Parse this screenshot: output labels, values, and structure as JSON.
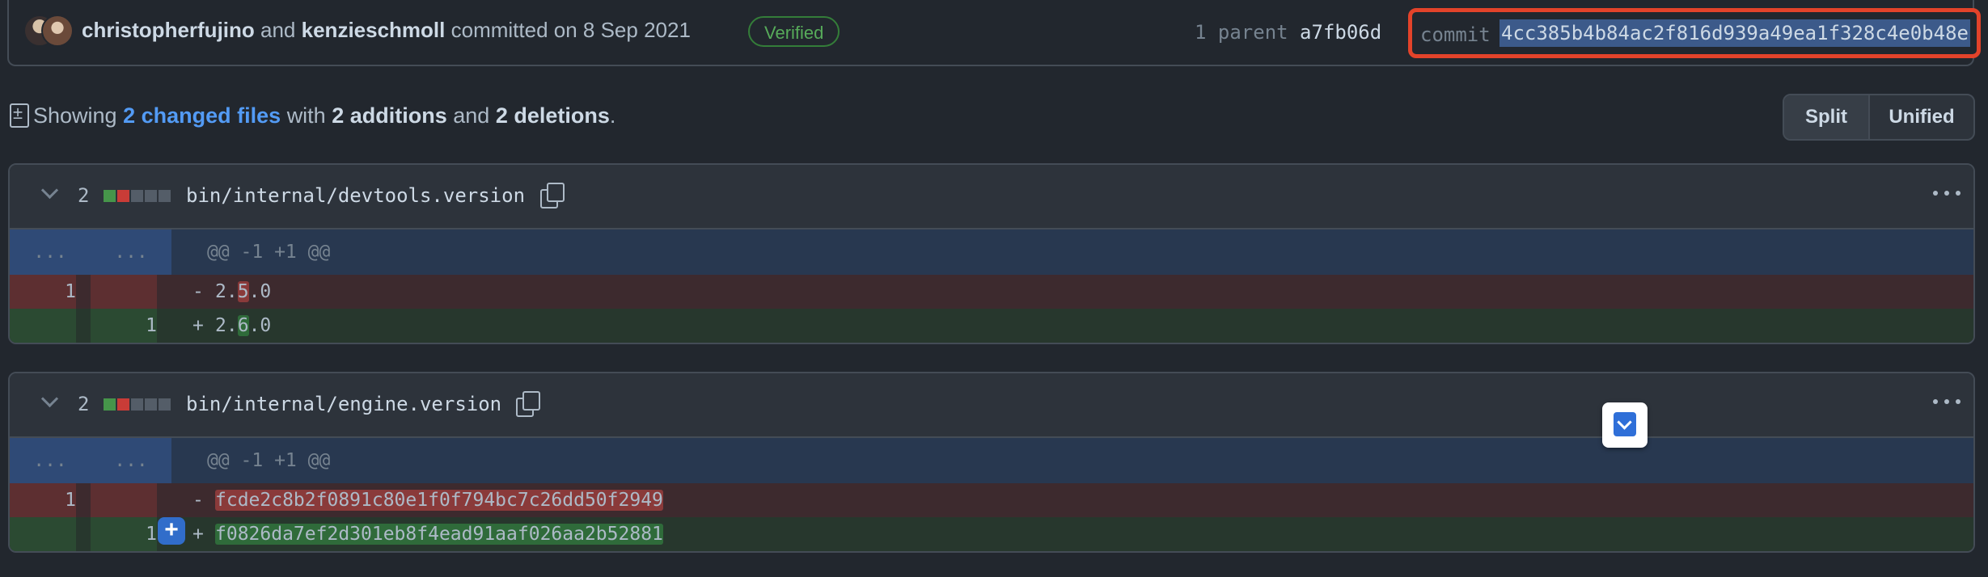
{
  "commit": {
    "author1": "christopherfujino",
    "joiner": "and",
    "author2": "kenzieschmoll",
    "committed_on": "committed on 8 Sep 2021",
    "verified_label": "Verified",
    "parent_label": "1 parent",
    "parent_sha": "a7fb06d",
    "commit_label": "commit",
    "commit_sha": "4cc385b4b84ac2f816d939a49ea1f328c4e0b48e"
  },
  "summary": {
    "showing": "Showing",
    "changed_files": "2 changed files",
    "with": "with",
    "additions": "2 additions",
    "and": "and",
    "deletions": "2 deletions",
    "period": "."
  },
  "view_toggle": {
    "split": "Split",
    "unified": "Unified"
  },
  "files": [
    {
      "count": "2",
      "name": "bin/internal/devtools.version",
      "hunk_ln": "...",
      "hunk": "@@ -1 +1 @@",
      "del_ln": "1",
      "del_sign": "-",
      "del_pre": "2.",
      "del_hl": "5",
      "del_post": ".0",
      "add_ln": "1",
      "add_sign": "+",
      "add_pre": "2.",
      "add_hl": "6",
      "add_post": ".0"
    },
    {
      "count": "2",
      "name": "bin/internal/engine.version",
      "hunk_ln": "...",
      "hunk": "@@ -1 +1 @@",
      "del_ln": "1",
      "del_sign": "-",
      "del_text": "fcde2c8b2f0891c80e1f0f794bc7c26dd50f2949",
      "add_ln": "1",
      "add_sign": "+",
      "add_text": "f0826da7ef2d301eb8f4ead91aaf026aa2b52881"
    }
  ],
  "colors": {
    "verified": "#57ab5a",
    "link": "#539bf5",
    "highlight_box": "#e3432a"
  }
}
